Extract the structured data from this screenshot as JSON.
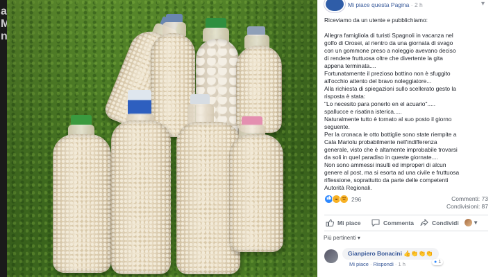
{
  "header": {
    "page_like_label": "Mi piace questa Pagina",
    "separator": "·",
    "time": "2 h",
    "caret": "▾"
  },
  "post": {
    "lines": [
      "Riceviamo da un utente e pubblichiamo:",
      "",
      "Allegra famigliola di turisti Spagnoli in vacanza nel",
      "golfo di Orosei, al rientro da una giornata di svago",
      "con un gommone preso a noleggio avevano deciso",
      "di rendere fruttuosa oltre che divertente la gita",
      "appena terminata....",
      "Fortunatamente il prezioso bottino non è sfuggito",
      "all'occhio attento del bravo noleggiatore...",
      "Alla richiesta di spiegazioni sullo scellerato gesto la",
      "risposta è stata:",
      "\"Lo necesito para ponerlo en el acuario\".....",
      "spallucce e risatina isterica.....",
      "Naturalmente tutto è tornato al suo posto il giorno",
      "seguente.",
      "Per la cronaca le otto bottiglie sono state riempite a",
      "Cala Mariolu probabilmente nell'indifferenza",
      "generale, visto che è altamente improbabile trovarsi",
      "da soli in quel paradiso in queste giornate....",
      "Non sono ammessi insulti ed improperi di alcun",
      "genere al post, ma si esorta ad una civile e fruttuosa",
      "riflessione, soprattutto da parte delle competenti",
      "Autorità Regionali."
    ]
  },
  "stats": {
    "reaction_count": "296",
    "comments": "Commenti: 73",
    "shares": "Condivisioni: 87"
  },
  "actions": {
    "like": "Mi piace",
    "comment": "Commenta",
    "share": "Condividi",
    "more": "▾"
  },
  "comments_section": {
    "filter_label": "Più pertinenti ▾",
    "first_comment": {
      "author": "Gianpiero Bonacini",
      "emojis": "👍👏👏👏",
      "like_action": "Mi piace",
      "reply_action": "Rispondi",
      "separator": "·",
      "time": "1 h",
      "like_count": "1"
    }
  },
  "colors": {
    "accent": "#365899",
    "like_blue": "#2d88ff",
    "text": "#1d2129",
    "muted": "#606770"
  },
  "left_edge_glyphs": [
    "al",
    "Mi",
    "no"
  ]
}
